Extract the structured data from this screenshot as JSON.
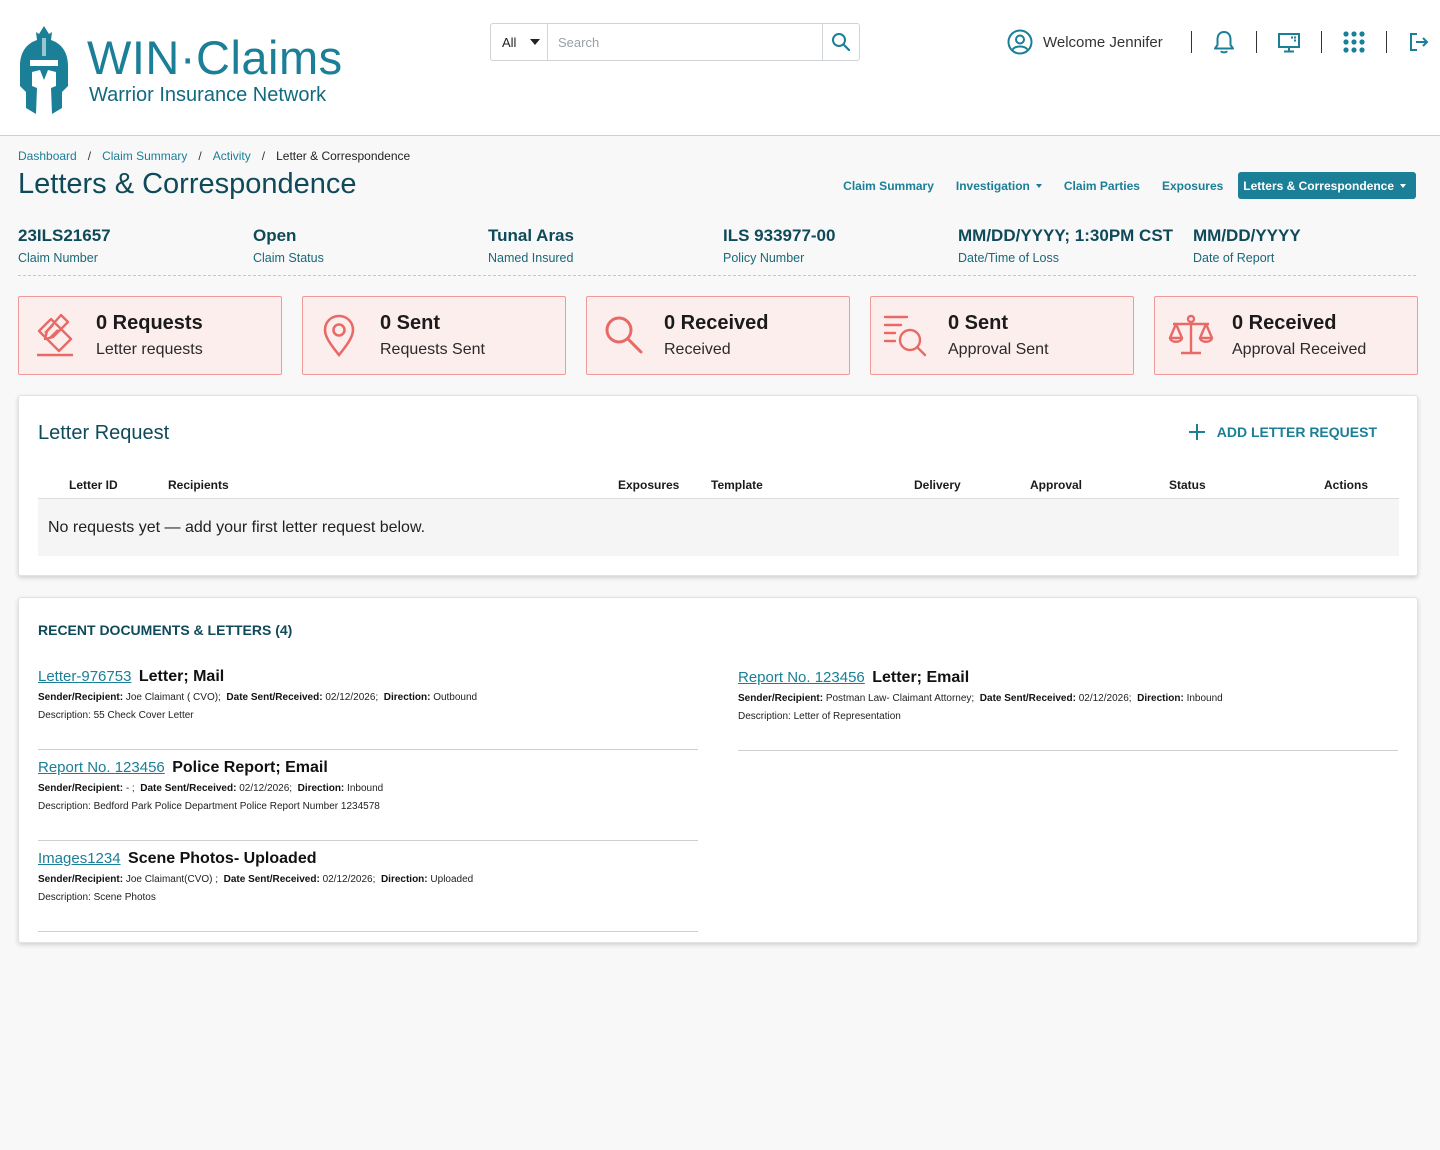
{
  "brand": {
    "title": "WIN·Claims",
    "subtitle": "Warrior Insurance Network",
    "color": "#1a7f97"
  },
  "search": {
    "scope": "All",
    "placeholder": "Search",
    "value": ""
  },
  "user": {
    "welcome": "Welcome Jennifer"
  },
  "toolbar": {
    "icons": [
      "bell-icon",
      "computer-screen-icon",
      "app-grid-icon",
      "logout-icon"
    ]
  },
  "breadcrumb": {
    "items": [
      "Dashboard",
      "Claim Summary",
      "Activity"
    ],
    "separator": "/",
    "current": "Letter & Correspondence"
  },
  "page": {
    "title": "Letters & Correspondence"
  },
  "subnav": {
    "items": [
      "Claim Summary",
      "Investigation",
      "Claim Parties",
      "Exposures",
      "Letters & Correspondence"
    ],
    "active": "Letters & Correspondence"
  },
  "claim": {
    "facts": [
      {
        "value": "23ILS21657",
        "label": "Claim Number"
      },
      {
        "value": "Open",
        "label": "Claim Status"
      },
      {
        "value": "Tunal Aras",
        "label": "Named Insured"
      },
      {
        "value": "ILS 933977-00",
        "label": "Policy Number"
      },
      {
        "value": "MM/DD/YYYY; 1:30PM CST",
        "label": "Date/Time of Loss"
      },
      {
        "value": "MM/DD/YYYY",
        "label": "Date of Report"
      }
    ]
  },
  "stats": [
    {
      "count": "0 Requests",
      "label": "Letter requests",
      "icon": "pen-paper-icon"
    },
    {
      "count": "0 Sent",
      "label": "Requests Sent",
      "icon": "map-pin-icon"
    },
    {
      "count": "0 Received",
      "label": "Received",
      "icon": "magnifier-icon"
    },
    {
      "count": "0 Sent",
      "label": "Approval Sent",
      "icon": "list-search-icon"
    },
    {
      "count": "0 Received",
      "label": "Approval Received",
      "icon": "scales-icon"
    }
  ],
  "stat_colors": {
    "bg": "#fdeeee",
    "border": "#ef9a98",
    "icon": "#e86a66"
  },
  "letter_request": {
    "title": "Letter Request",
    "add_label": "ADD LETTER REQUEST",
    "columns": [
      "Letter ID",
      "Recipients",
      "Exposures",
      "Template",
      "Delivery",
      "Approval",
      "Status",
      "Actions"
    ],
    "empty_text": "No requests yet — add your first letter request below."
  },
  "recent": {
    "title": "RECENT DOCUMENTS & LETTERS (4)",
    "docs": [
      {
        "id": "Letter-976753",
        "type": "Letter; Mail",
        "sender_label": "Sender/Recipient:",
        "sender": "Joe Claimant ( CVO);",
        "date_label": "Date Sent/Received:",
        "date": "02/12/2026;",
        "direction_label": "Direction:",
        "direction": "Outbound",
        "description": "Description: 55 Check Cover Letter"
      },
      {
        "id": "Report No. 123456",
        "type": "Letter; Email",
        "sender_label": "Sender/Recipient:",
        "sender": "Postman Law- Claimant Attorney;",
        "date_label": "Date Sent/Received:",
        "date": "02/12/2026;",
        "direction_label": "Direction:",
        "direction": "Inbound",
        "description": "Description: Letter of Representation"
      },
      {
        "id": "Report No. 123456",
        "type": "Police Report; Email",
        "sender_label": "Sender/Recipient:",
        "sender": "- ;",
        "date_label": "Date Sent/Received:",
        "date": "02/12/2026;",
        "direction_label": "Direction:",
        "direction": "Inbound",
        "description": "Description: Bedford Park Police Department Police Report Number 1234578"
      },
      {
        "id": "Images1234",
        "type": "Scene Photos- Uploaded",
        "sender_label": "Sender/Recipient:",
        "sender": "Joe Claimant(CVO) ;",
        "date_label": "Date Sent/Received:",
        "date": "02/12/2026;",
        "direction_label": "Direction:",
        "direction": "Uploaded",
        "description": "Description: Scene Photos"
      }
    ]
  }
}
